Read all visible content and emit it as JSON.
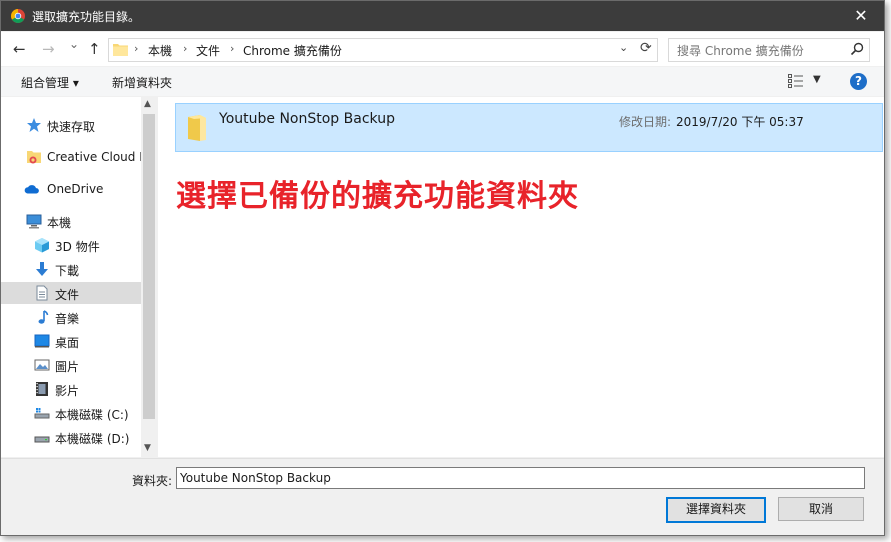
{
  "window": {
    "title": "選取擴充功能目錄。",
    "close": "✕"
  },
  "nav": {
    "back": "←",
    "forward": "→",
    "recent": "⌄",
    "up": "↑",
    "breadcrumb": [
      "本機",
      "文件",
      "Chrome 擴充備份"
    ],
    "dropdown": "⌄",
    "refresh": "⟳"
  },
  "search": {
    "placeholder": "搜尋 Chrome 擴充備份"
  },
  "toolbar": {
    "organize": "組合管理 ▾",
    "new_folder": "新增資料夾",
    "view_dd": "▼",
    "help": "?"
  },
  "sidebar": {
    "items": [
      {
        "label": "快速存取",
        "icon": "star-icon"
      },
      {
        "label": "Creative Cloud Fi",
        "icon": "creative-cloud-icon"
      },
      {
        "label": "OneDrive",
        "icon": "onedrive-icon"
      },
      {
        "label": "本機",
        "icon": "computer-icon"
      },
      {
        "label": "3D 物件",
        "icon": "cube-icon"
      },
      {
        "label": "下載",
        "icon": "download-icon"
      },
      {
        "label": "文件",
        "icon": "document-icon"
      },
      {
        "label": "音樂",
        "icon": "music-icon"
      },
      {
        "label": "桌面",
        "icon": "desktop-icon"
      },
      {
        "label": "圖片",
        "icon": "picture-icon"
      },
      {
        "label": "影片",
        "icon": "video-icon"
      },
      {
        "label": "本機磁碟 (C:)",
        "icon": "drive-c-icon"
      },
      {
        "label": "本機磁碟 (D:)",
        "icon": "drive-d-icon"
      }
    ],
    "selected": "文件",
    "scroll_up": "▲",
    "scroll_down": "▼"
  },
  "main": {
    "folder": {
      "name": "Youtube NonStop Backup",
      "date_label": "修改日期:",
      "date": "2019/7/20 下午 05:37"
    },
    "annotation": "選擇已備份的擴充功能資料夾"
  },
  "bottom": {
    "field_label": "資料夾:",
    "field_value": "Youtube NonStop Backup",
    "select_button": "選擇資料夾",
    "cancel_button": "取消"
  },
  "colors": {
    "titlebar": "#3c3c3c",
    "selection": "#cce8ff",
    "annotation": "#e8232a",
    "accent": "#0078d7"
  }
}
